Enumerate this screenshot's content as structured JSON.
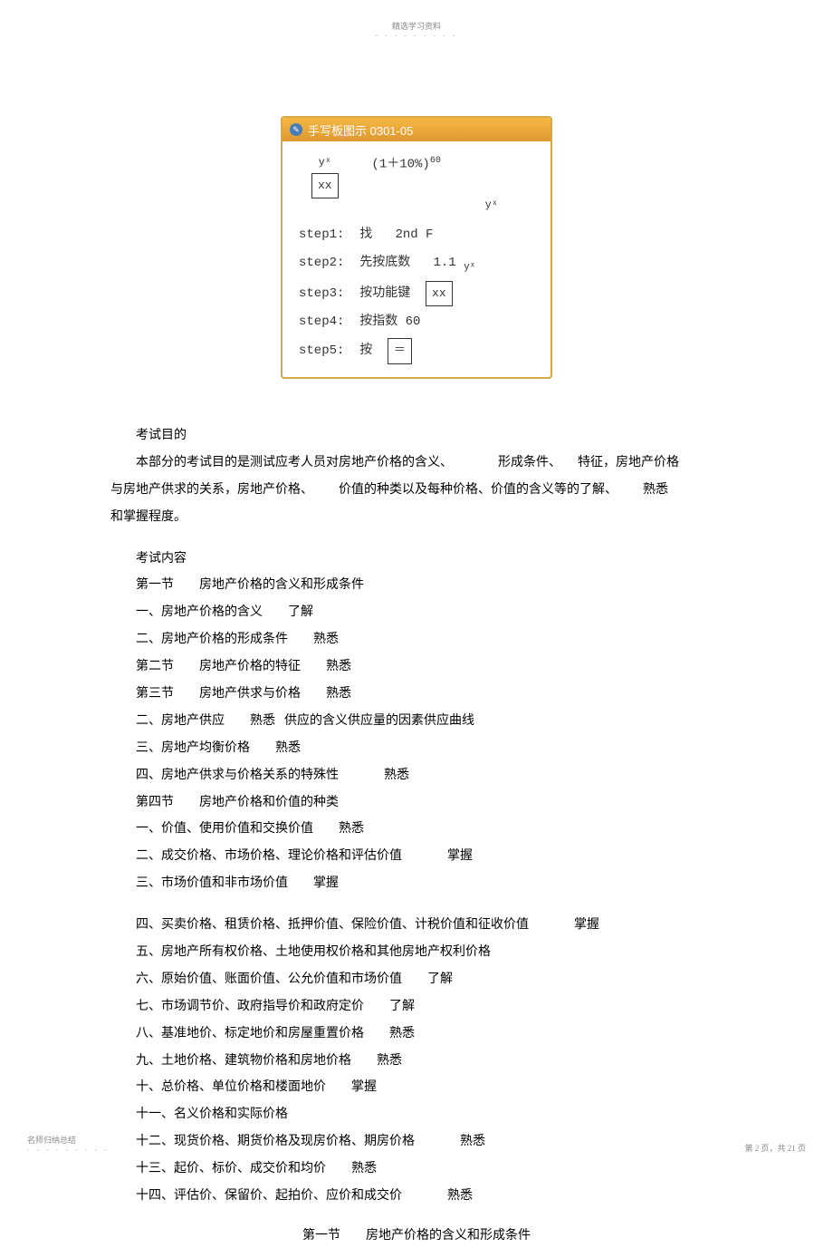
{
  "header": {
    "top_text": "精选学习资料",
    "dashes": "- - - - - - - - -"
  },
  "figure": {
    "title": "手写板图示 0301-05",
    "yx": "yˣ",
    "boxed_xx": "xx",
    "formula_main": "(1＋10%)",
    "formula_exp": "60",
    "formula_trail": "yˣ",
    "steps": [
      {
        "label": "step1:",
        "text": "找",
        "extra": "2nd F"
      },
      {
        "label": "step2:",
        "text": "先按底数",
        "extra": "1.1",
        "sub": "yˣ"
      },
      {
        "label": "step3:",
        "text": "按功能键",
        "boxed": "xx"
      },
      {
        "label": "step4:",
        "text": "按指数 60"
      },
      {
        "label": "step5:",
        "text": "按",
        "boxed": "＝"
      }
    ]
  },
  "body": {
    "purpose_title": "考试目的",
    "purpose_p1a": "本部分的考试目的是测试应考人员对房地产价格的含义、",
    "purpose_p1b": "形成条件、",
    "purpose_p1c": "特征，房地产价格",
    "purpose_p2a": "与房地产供求的关系，房地产价格、",
    "purpose_p2b": "价值的种类以及每种价格、价值的含义等的了解、",
    "purpose_p2c": "熟悉",
    "purpose_p3": "和掌握程度。",
    "content_title": "考试内容",
    "lines": [
      {
        "a": "第一节",
        "b": "房地产价格的含义和形成条件"
      },
      {
        "a": "一、房地产价格的含义",
        "b": "了解"
      },
      {
        "a": "二、房地产价格的形成条件",
        "b": "熟悉"
      },
      {
        "a": "第二节",
        "b": "房地产价格的特征",
        "c": "熟悉"
      },
      {
        "a": "第三节",
        "b": "房地产供求与价格",
        "c": "熟悉"
      },
      {
        "a": "二、房地产供应",
        "b": "熟悉",
        "c": "供应的含义供应量的因素供应曲线"
      },
      {
        "a": "三、房地产均衡价格",
        "b": "熟悉"
      },
      {
        "a": "四、房地产供求与价格关系的特殊性",
        "b": "熟悉"
      },
      {
        "a": "第四节",
        "b": "房地产价格和价值的种类"
      },
      {
        "a": "一、价值、使用价值和交换价值",
        "b": "熟悉"
      },
      {
        "a": "二、成交价格、市场价格、理论价格和评估价值",
        "b": "掌握"
      },
      {
        "a": "三、市场价值和非市场价值",
        "b": "掌握"
      }
    ],
    "lines2": [
      {
        "a": "四、买卖价格、租赁价格、抵押价值、保险价值、计税价值和征收价值",
        "b": "掌握"
      },
      {
        "a": "五、房地产所有权价格、土地使用权价格和其他房地产权利价格"
      },
      {
        "a": "六、原始价值、账面价值、公允价值和市场价值",
        "b": "了解"
      },
      {
        "a": "七、市场调节价、政府指导价和政府定价",
        "b": "了解"
      },
      {
        "a": "八、基准地价、标定地价和房屋重置价格",
        "b": "熟悉"
      },
      {
        "a": "九、土地价格、建筑物价格和房地价格",
        "b": "熟悉"
      },
      {
        "a": "十、总价格、单位价格和楼面地价",
        "b": "掌握"
      },
      {
        "a": "十一、名义价格和实际价格"
      },
      {
        "a": "十二、现货价格、期货价格及现房价格、期房价格",
        "b": "熟悉"
      },
      {
        "a": "十三、起价、标价、成交价和均价",
        "b": "熟悉"
      },
      {
        "a": "十四、评估价、保留价、起拍价、应价和成交价",
        "b": "熟悉"
      }
    ],
    "section1_title_a": "第一节",
    "section1_title_b": "房地产价格的含义和形成条件"
  },
  "footer": {
    "left": "名师归纳总结",
    "dashes": "- - - - - - - - -",
    "right": "第 2 页，共 21 页"
  }
}
